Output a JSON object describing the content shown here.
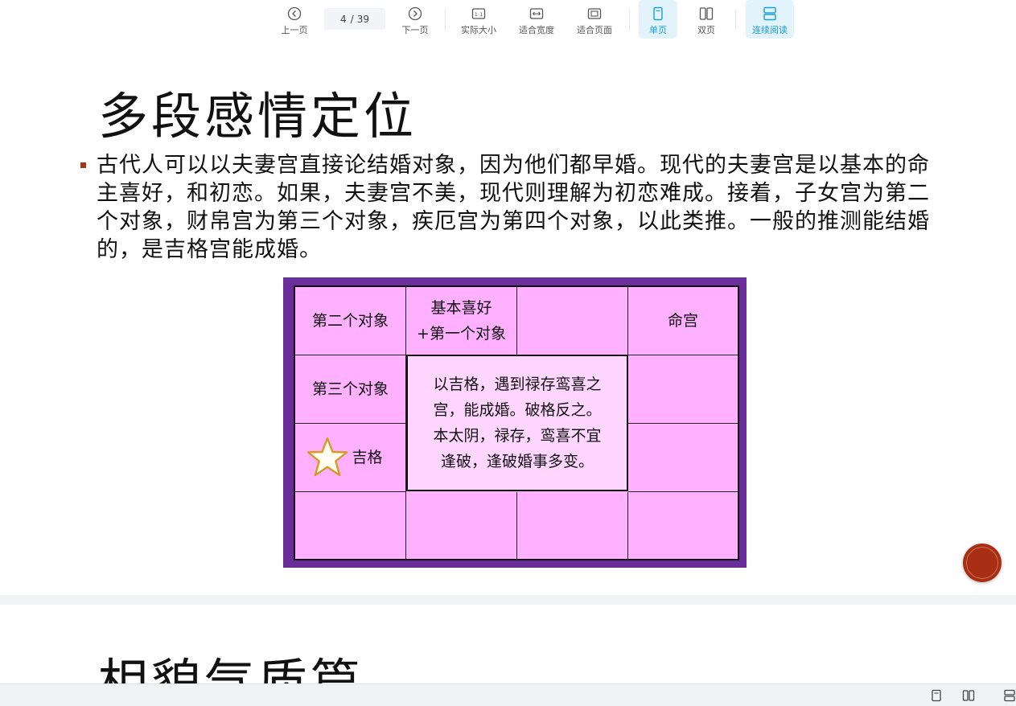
{
  "toolbar": {
    "prev_label": "上一页",
    "next_label": "下一页",
    "current_page": "4",
    "page_separator": "/",
    "total_pages": "39",
    "actual_size_label": "实际大小",
    "fit_width_label": "适合宽度",
    "fit_page_label": "适合页面",
    "single_page_label": "单页",
    "double_page_label": "双页",
    "continuous_label": "连续阅读",
    "accent_color": "#1a9fd8"
  },
  "page": {
    "title": "多段感情定位",
    "bullet": "古代人可以以夫妻宫直接论结婚对象，因为他们都早婚。现代的夫妻宫是以基本的命主喜好，和初恋。如果，夫妻宫不美，现代则理解为初恋难成。接着，子女宫为第二个对象，财帛宫为第三个对象，疾厄宫为第四个对象，以此类推。一般的推测能结婚的，是吉格宫能成婚。",
    "bullet_color": "#a03818"
  },
  "board": {
    "frame_color": "#6a2e9a",
    "cell_color": "#ffb0ff",
    "center_color": "#ffd6ff",
    "cells": {
      "r1c1": "第二个对象",
      "r1c2_line1": "基本喜好",
      "r1c2_line2": "+第一个对象",
      "r1c3": "",
      "r1c4": "命宫",
      "r2c1": "第三个对象",
      "r2c4": "",
      "r3c1": "吉格",
      "r3c4": "",
      "r4c1": "",
      "r4c2": "",
      "r4c3": "",
      "r4c4": ""
    },
    "center_line1": "以吉格，遇到禄存鸾喜之",
    "center_line2": "宫，能成婚。破格反之。",
    "center_line3": "本太阴，禄存，鸾喜不宜",
    "center_line4": "逢破，逢破婚事多变。",
    "star_icon": "star-icon"
  },
  "next_page": {
    "title": "相貌气质篇"
  },
  "fab": {
    "color": "#a82e14"
  }
}
